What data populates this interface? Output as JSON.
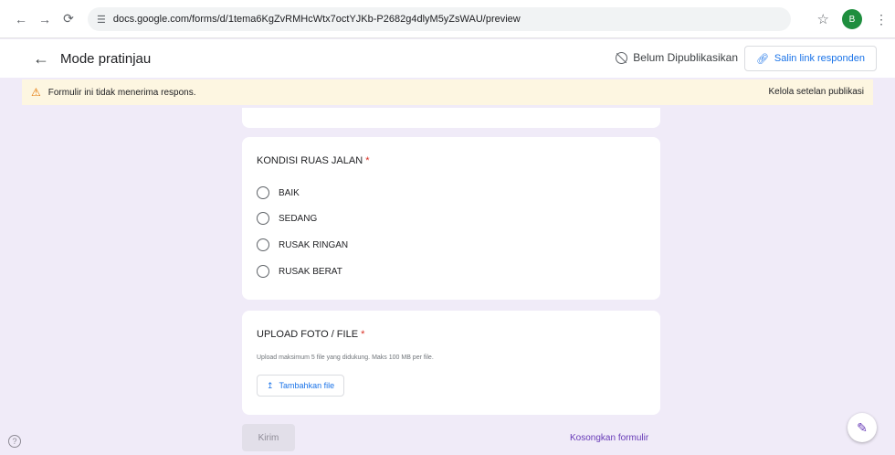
{
  "browser": {
    "url": "docs.google.com/forms/d/1tema6KgZvRMHcWtx7octYJKb-P2682g4dlyM5yZsWAU/preview",
    "profile_initial": "B",
    "icons": [
      "back-icon",
      "forward-icon",
      "reload-icon",
      "site-settings-icon",
      "bookmark-star-icon",
      "more-icon"
    ]
  },
  "preview_header": {
    "title": "Mode pratinjau",
    "status": "Belum Dipublikasikan",
    "copy_link_label": "Salin link responden"
  },
  "notice": {
    "text": "Formulir ini tidak menerima respons.",
    "action": "Kelola setelan publikasi"
  },
  "questions": [
    {
      "title": "KONDISI RUAS JALAN",
      "required_mark": "*",
      "options": [
        "BAIK",
        "SEDANG",
        "RUSAK RINGAN",
        "RUSAK BERAT"
      ]
    },
    {
      "title": "UPLOAD FOTO / FILE",
      "required_mark": "*",
      "description": "Upload maksimum 5 file yang didukung. Maks 100 MB per file.",
      "button_label": "Tambahkan file"
    }
  ],
  "footer": {
    "submit_label": "Kirim",
    "clear_label": "Kosongkan formulir"
  },
  "colors": {
    "page_bg": "#f0ebf8",
    "accent": "#673ab7",
    "link_blue": "#1a73e8",
    "notice_bg": "#fdf6e1",
    "required_red": "#d93025"
  }
}
